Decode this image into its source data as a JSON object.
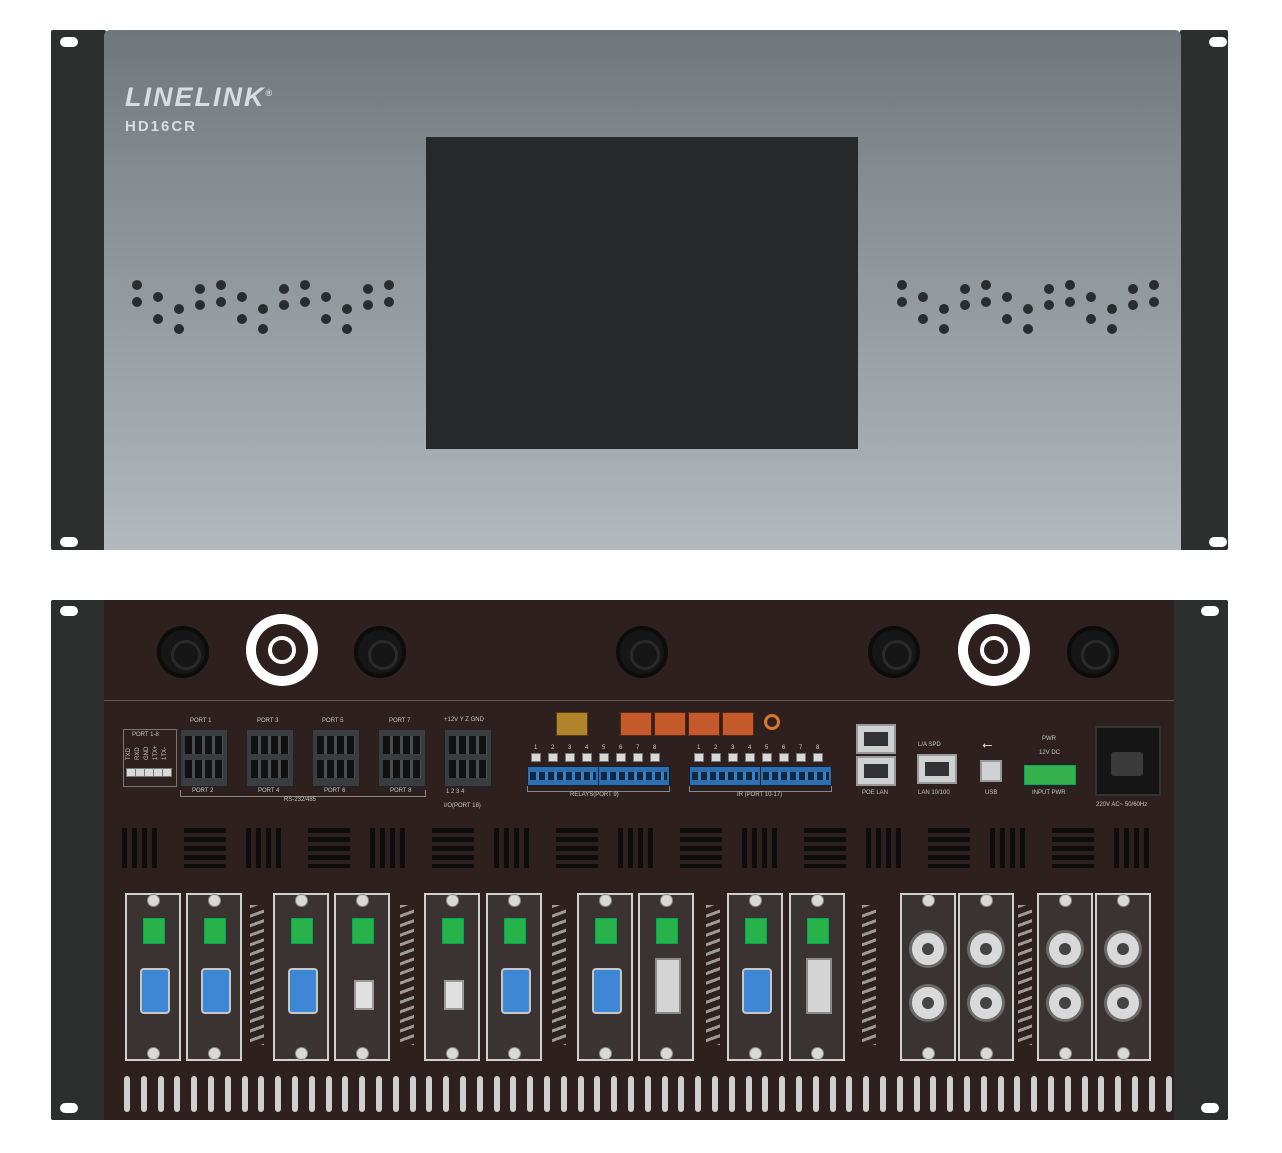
{
  "front_panel": {
    "brand": "LINELINK",
    "brand_mark": "®",
    "model": "HD16CR"
  },
  "rear_panel": {
    "port_labels": {
      "port_1_8": "PORT 1-8",
      "side_pins": [
        "TXD",
        "RXD",
        "GND",
        "1TX+",
        "1TX-"
      ],
      "port1": "PORT 1",
      "port3": "PORT 3",
      "port5": "PORT 5",
      "port7": "PORT 7",
      "port2": "PORT 2",
      "port4": "PORT 4",
      "port6": "PORT 6",
      "port8": "PORT 8",
      "rs232": "RS-232/485",
      "io_top": "+12V  Y  Z  GND",
      "io_nums": "1 2 3 4",
      "io": "I/O(PORT 18)",
      "relays": "RELAYS(PORT 9)",
      "ir": "IR (PORT 10-17)",
      "poe_lan": "POE LAN",
      "la_spd": "L/A    SPD",
      "lan": "LAN 10/100",
      "usb": "USB",
      "pwr": "PWR",
      "dc": "12V DC",
      "input_pwr": "INPUT PWR",
      "ac": "220V AC~ 50/60Hz"
    },
    "relay_numbers": [
      "1",
      "2",
      "3",
      "4",
      "5",
      "6",
      "7",
      "8"
    ],
    "ir_numbers": [
      "1",
      "2",
      "3",
      "4",
      "5",
      "6",
      "7",
      "8"
    ]
  }
}
